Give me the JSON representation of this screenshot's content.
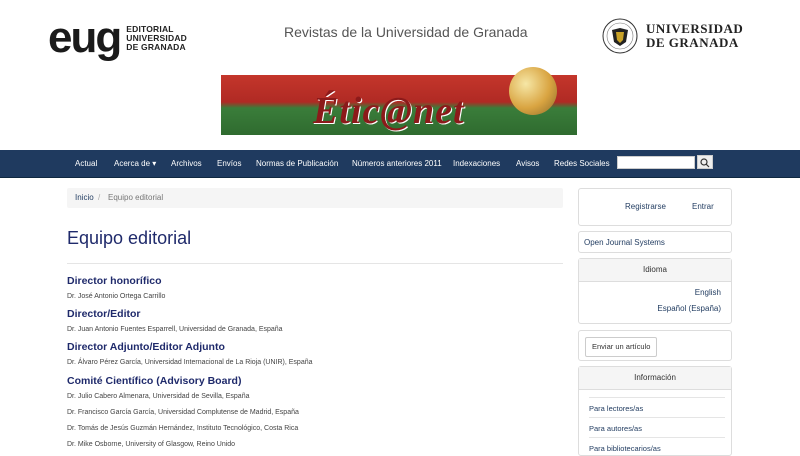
{
  "header": {
    "eug_mark": "eug",
    "eug_text": [
      "EDITORIAL",
      "UNIVERSIDAD",
      "DE GRANADA"
    ],
    "site_title": "Revistas de la Universidad de Granada",
    "ugr_text": [
      "UNIVERSIDAD",
      "DE GRANADA"
    ],
    "banner_word": "Étic@net"
  },
  "nav": {
    "items": [
      "Actual",
      "Acerca de ▾",
      "Archivos",
      "Envíos",
      "Normas de Publicación",
      "Números anteriores 2011",
      "Indexaciones",
      "Avisos",
      "Redes Sociales"
    ],
    "search_placeholder": ""
  },
  "breadcrumb": {
    "home": "Inicio",
    "sep": "/",
    "current": "Equipo editorial"
  },
  "page_title": "Equipo editorial",
  "sections": [
    {
      "title": "Director honorífico",
      "members": [
        "Dr. José Antonio Ortega Carrillo"
      ]
    },
    {
      "title": "Director/Editor",
      "members": [
        "Dr. Juan Antonio Fuentes Esparrell, Universidad de Granada, España"
      ]
    },
    {
      "title": "Director Adjunto/Editor Adjunto",
      "members": [
        "Dr. Álvaro Pérez García, Universidad Internacional de La Rioja (UNIR), España"
      ]
    },
    {
      "title": "Comité Científico (Advisory Board)",
      "members": [
        "Dr. Julio Cabero Almenara, Universidad de Sevilla, España",
        "Dr. Francisco García García, Universidad Complutense de Madrid, España",
        "Dr. Tomás de Jesús Guzmán Hernández, Instituto Tecnológico, Costa Rica",
        "Dr. Mike Osborne, University of Glasgow, Reino Unido"
      ]
    }
  ],
  "sidebar": {
    "user": {
      "register": "Registrarse",
      "login": "Entrar"
    },
    "ojs": "Open Journal Systems",
    "language": {
      "title": "Idioma",
      "options": [
        "English",
        "Español (España)"
      ]
    },
    "submit": "Enviar un artículo",
    "info": {
      "title": "Información",
      "links": [
        "Para lectores/as",
        "Para autores/as",
        "Para bibliotecarios/as"
      ]
    }
  }
}
